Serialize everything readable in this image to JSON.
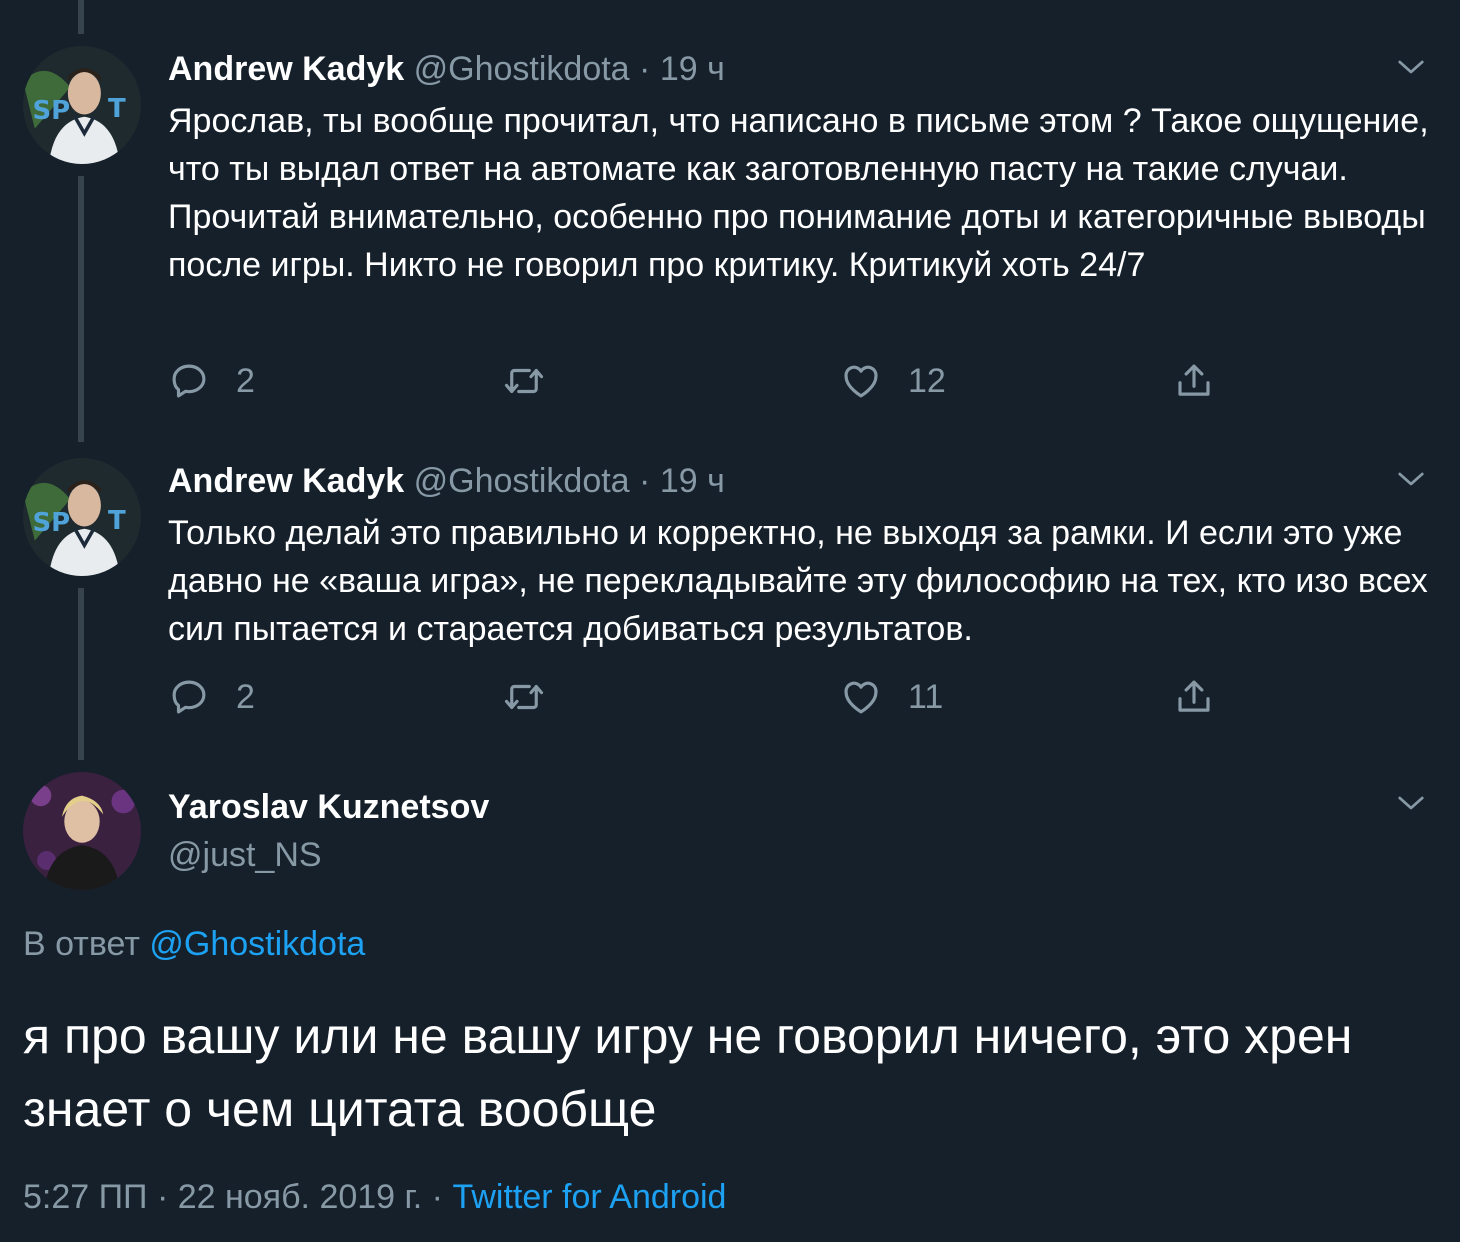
{
  "tweets": [
    {
      "name": "Andrew Kadyk",
      "handle": "@Ghostikdota",
      "dot": "·",
      "time": "19 ч",
      "text": "Ярослав, ты вообще прочитал, что написано в письме этом ? Такое ощущение, что ты выдал ответ на автомате как заготовленную пасту на такие случаи. Прочитай внимательно, особенно про понимание доты и категоричные выводы после игры. Никто не говорил про критику. Критикуй хоть 24/7",
      "replies": "2",
      "likes": "12"
    },
    {
      "name": "Andrew Kadyk",
      "handle": "@Ghostikdota",
      "dot": "·",
      "time": "19 ч",
      "text": "Только делай это правильно и корректно, не выходя за рамки. И если это уже давно не «ваша игра», не перекладывайте эту философию на тех, кто изо всех сил пытается и старается добиваться результатов.",
      "replies": "2",
      "likes": "11"
    }
  ],
  "main": {
    "name": "Yaroslav Kuznetsov",
    "handle": "@just_NS",
    "reply_prefix": "В ответ",
    "reply_to": "@Ghostikdota",
    "text": "я про вашу или не вашу игру не говорил ничего, это хрен знает о чем цитата вообще",
    "datetime": "5:27 ПП · 22 нояб. 2019 г. ·",
    "source": "Twitter for Android"
  },
  "icons": [
    "reply-icon",
    "retweet-icon",
    "like-icon",
    "share-icon",
    "chevron-down-icon"
  ],
  "colors": {
    "background": "#15202b",
    "secondary_text": "#8899a6",
    "link": "#1da1f2",
    "thread_line": "#38444d"
  }
}
